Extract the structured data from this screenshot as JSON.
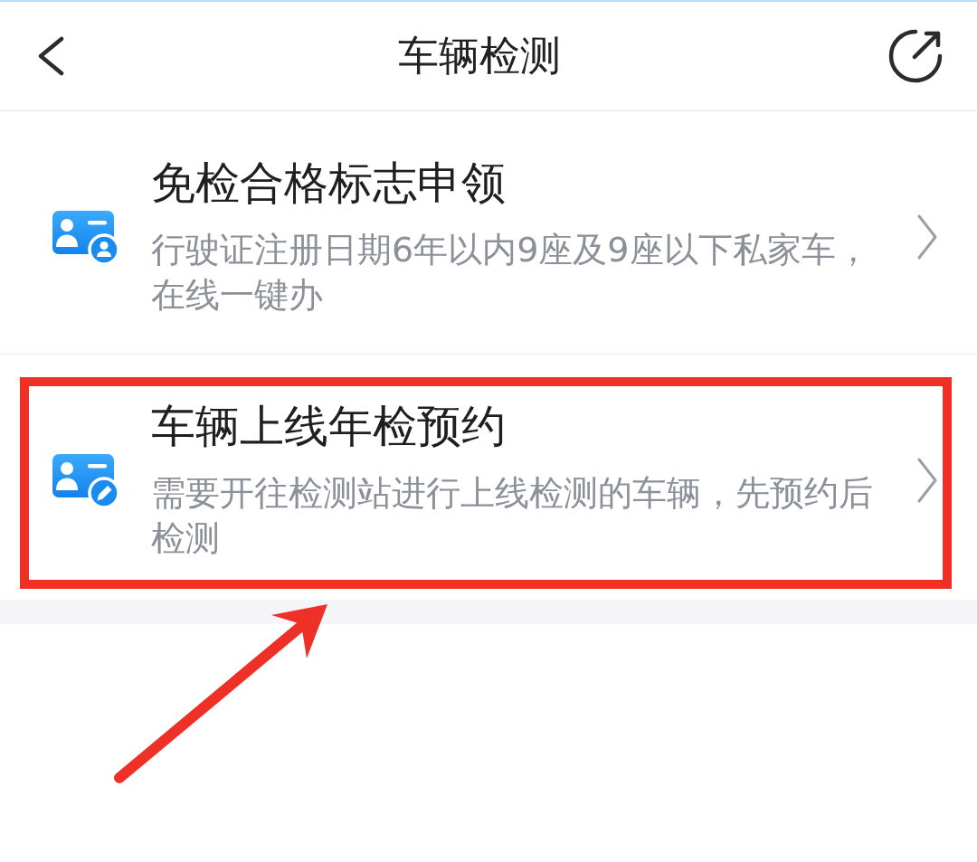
{
  "header": {
    "title": "车辆检测"
  },
  "items": [
    {
      "kind": "profile",
      "title": "免检合格标志申领",
      "description": "行驶证注册日期6年以内9座及9座以下私家车，在线一键办",
      "highlighted": false
    },
    {
      "kind": "edit",
      "title": "车辆上线年检预约",
      "description": "需要开往检测站进行上线检测的车辆，先预约后检测",
      "highlighted": true
    }
  ]
}
